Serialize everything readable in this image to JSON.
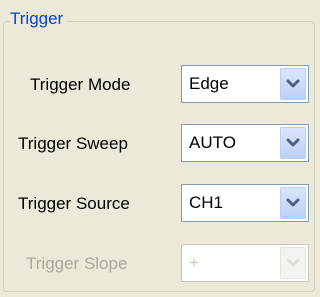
{
  "group": {
    "title": "Trigger"
  },
  "rows": [
    {
      "label": "Trigger Mode",
      "value": "Edge",
      "enabled": true
    },
    {
      "label": "Trigger Sweep",
      "value": "AUTO",
      "enabled": true
    },
    {
      "label": "Trigger Source",
      "value": "CH1",
      "enabled": true
    },
    {
      "label": "Trigger Slope",
      "value": "+",
      "enabled": false
    }
  ],
  "colors": {
    "title": "#0046d5",
    "arrow": "#4d6185",
    "disabled_text": "#aca899"
  },
  "icons": {
    "dropdown": "chevron-down-icon"
  }
}
